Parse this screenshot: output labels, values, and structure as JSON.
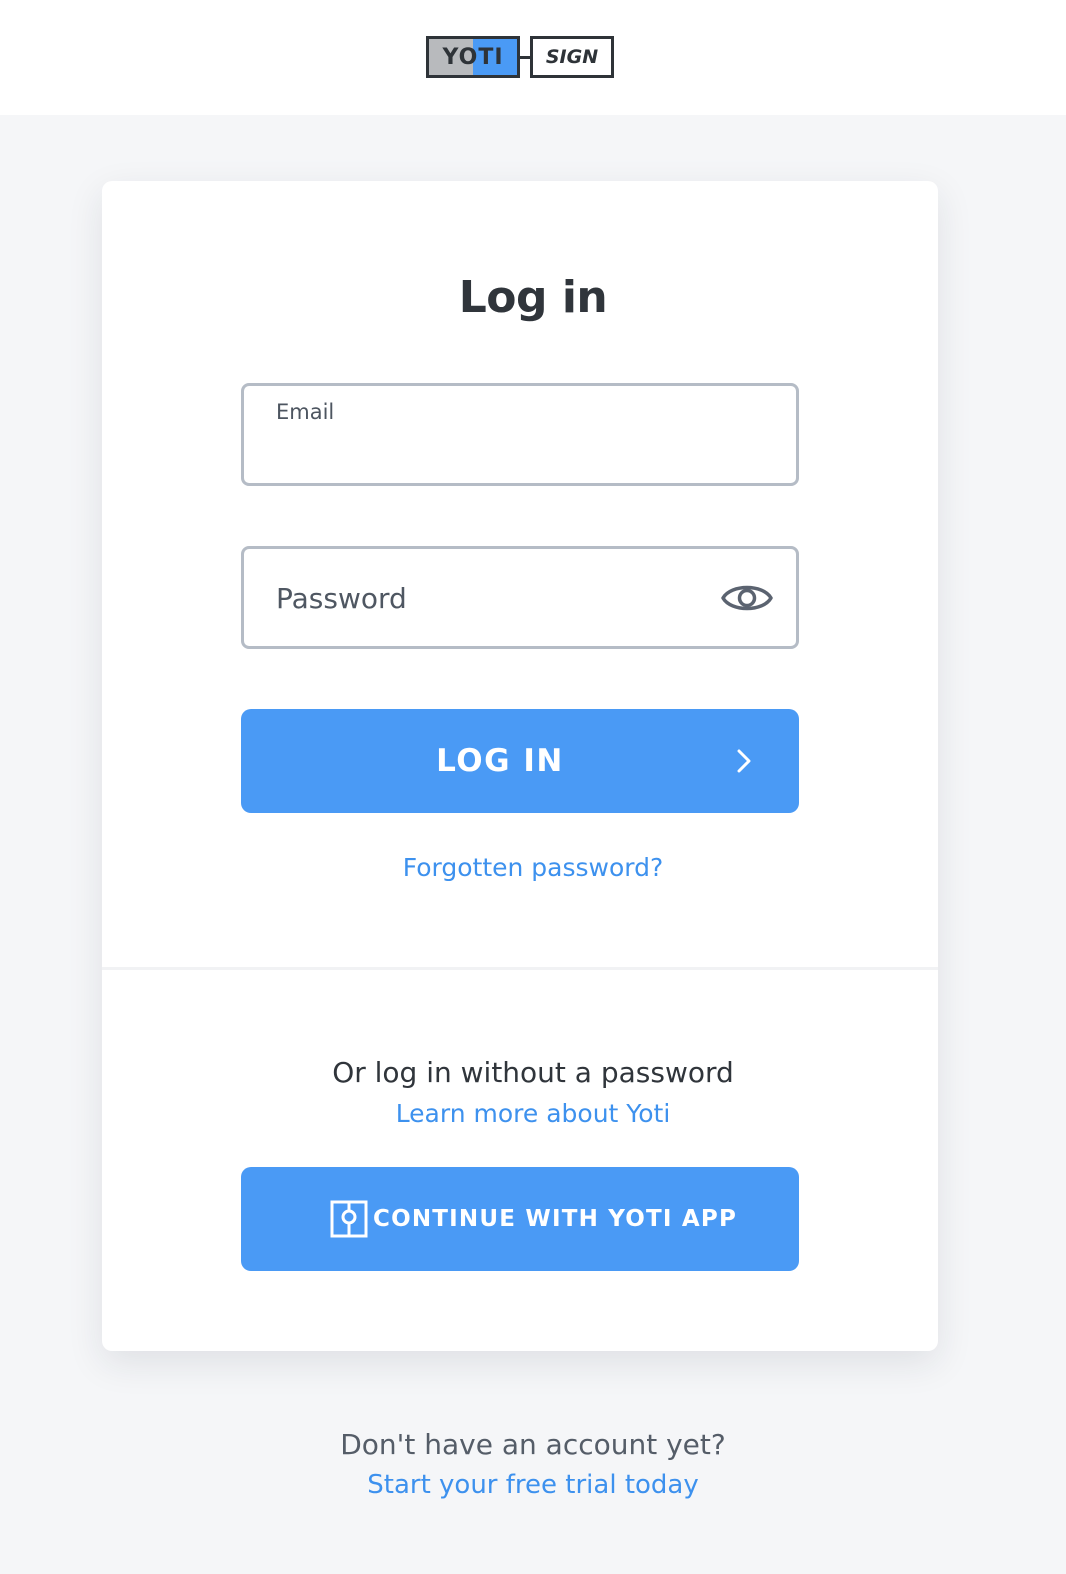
{
  "header": {
    "logo": {
      "brand": "YOTI",
      "product": "SIGN"
    }
  },
  "login": {
    "title": "Log in",
    "email_label": "Email",
    "email_value": "",
    "password_placeholder": "Password",
    "password_value": "",
    "submit_label": "LOG IN",
    "forgot_link": "Forgotten password?"
  },
  "passwordless": {
    "heading": "Or log in without a password",
    "learn_link": "Learn more about Yoti",
    "button_label": "CONTINUE WITH YOTI APP"
  },
  "footer": {
    "question": "Don't have an account yet?",
    "trial_link": "Start your free trial today"
  },
  "icons": {
    "password_toggle": "eye-icon",
    "submit_arrow": "chevron-right-icon",
    "yoti_app": "yoti-app-icon"
  },
  "colors": {
    "accent": "#4a9af5",
    "link": "#3d91ee",
    "background": "#f5f6f8",
    "text": "#30353b"
  }
}
